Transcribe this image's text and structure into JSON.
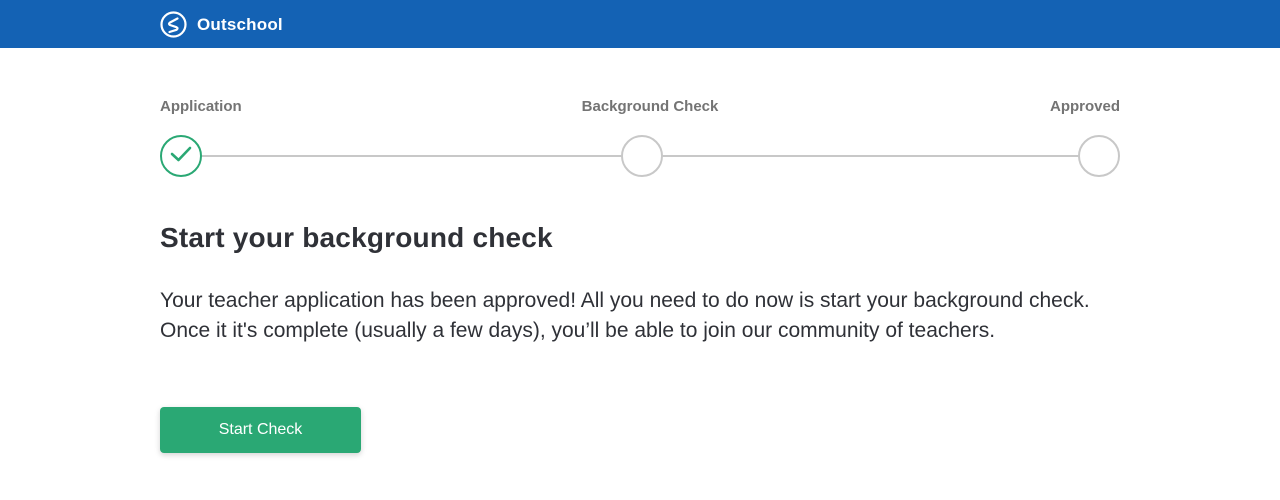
{
  "header": {
    "brand_name": "Outschool",
    "logo_icon": "outschool-logo-icon",
    "background_color": "#1462b4"
  },
  "progress": {
    "steps": [
      {
        "label": "Application",
        "status": "complete",
        "icon": "checkmark-icon"
      },
      {
        "label": "Background Check",
        "status": "pending"
      },
      {
        "label": "Approved",
        "status": "pending"
      }
    ],
    "complete_color": "#2aa874",
    "pending_color": "#c8c8c8"
  },
  "main": {
    "title": "Start your background check",
    "description": "Your teacher application has been approved! All you need to do now is start your background check. Once it it's complete (usually a few days), you’ll be able to join our community of teachers.",
    "start_button_label": "Start Check",
    "button_color": "#2aa874"
  }
}
